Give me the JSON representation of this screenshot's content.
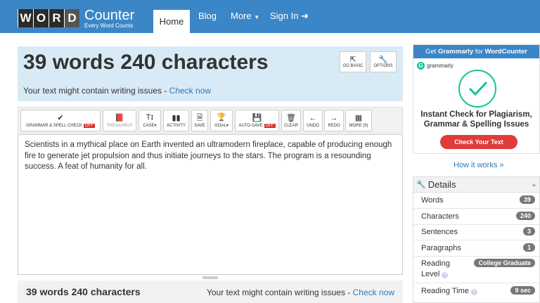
{
  "logo": {
    "letters": [
      "W",
      "O",
      "R",
      "D"
    ],
    "title": "Counter",
    "tagline": "Every Word Counts"
  },
  "nav": {
    "home": "Home",
    "blog": "Blog",
    "more": "More",
    "signin": "Sign In"
  },
  "hero": {
    "title": "39 words 240 characters",
    "note_prefix": "Your text might contain writing issues -",
    "check_link": "Check now",
    "go_basic": "GO BASIC",
    "options": "OPTIONS"
  },
  "toolbar": {
    "grammar": "GRAMMAR & SPELL CHECK",
    "grammar_badge": "OFF",
    "thesaurus": "THESAURUS",
    "case": "CASE",
    "activity": "ACTIVITY",
    "save": "SAVE",
    "goal": "GOAL",
    "autosave": "AUTO-SAVE",
    "autosave_badge": "OFF",
    "clear": "CLEAR",
    "undo": "UNDO",
    "redo": "REDO",
    "more": "MORE (9)"
  },
  "editor": {
    "text": "Scientists in a mythical place on Earth invented an ultramodern fireplace, capable of producing enough fire to generate jet propulsion and thus initiate journeys to the stars. The program is a resounding success. A feat of humanity for all."
  },
  "footer": {
    "title": "39 words 240 characters",
    "note_prefix": "Your text might contain writing issues -",
    "check_link": "Check now"
  },
  "ad": {
    "header_prefix": "Get",
    "header_brand": "Grammarly",
    "header_mid": "for",
    "header_site": "WordCounter",
    "brand": "grammarly",
    "headline": "Instant Check for Plagiarism, Grammar & Spelling Issues",
    "button": "Check Your Text"
  },
  "how_it_works": "How it works »",
  "details": {
    "title": "Details",
    "rows": [
      {
        "label": "Words",
        "value": "39"
      },
      {
        "label": "Characters",
        "value": "240"
      },
      {
        "label": "Sentences",
        "value": "3"
      },
      {
        "label": "Paragraphs",
        "value": "1"
      },
      {
        "label_line1": "Reading",
        "label_line2": "Level",
        "value": "College Graduate"
      },
      {
        "label": "Reading Time",
        "value": "9 sec"
      }
    ]
  },
  "colors": {
    "nav": "#3b86c7",
    "hero": "#d8eaf5",
    "badge_off": "#d9302c",
    "grammarly": "#15c39a",
    "cta": "#e03a3a"
  }
}
